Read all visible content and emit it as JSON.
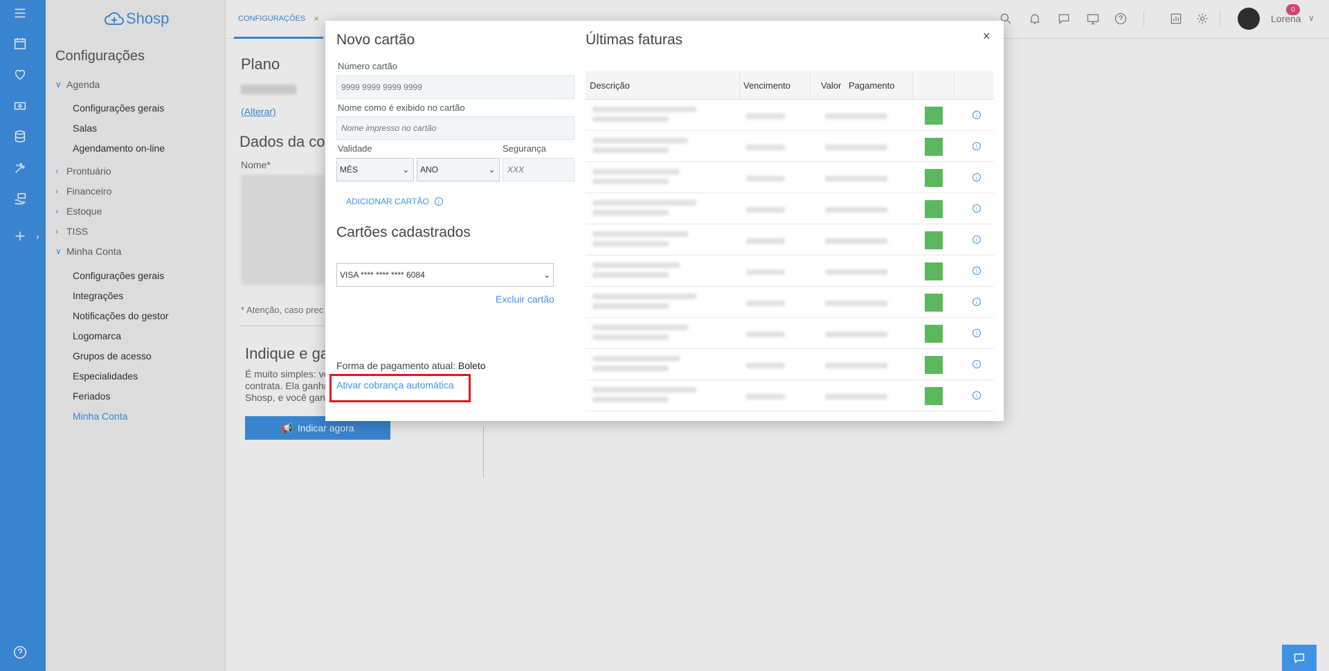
{
  "brand": {
    "name": "Shosp"
  },
  "topbar": {
    "tab_label": "CONFIGURAÇÕES",
    "tab_close": "×",
    "messages_badge": "0",
    "user_name": "Lorena"
  },
  "nav": {
    "title": "Configurações",
    "groups": [
      {
        "label": "Agenda",
        "expanded": true,
        "items": [
          "Configurações gerais",
          "Salas",
          "Agendamento on-line"
        ]
      },
      {
        "label": "Prontuário",
        "expanded": false
      },
      {
        "label": "Financeiro",
        "expanded": false
      },
      {
        "label": "Estoque",
        "expanded": false
      },
      {
        "label": "TISS",
        "expanded": false
      },
      {
        "label": "Minha Conta",
        "expanded": true,
        "items": [
          "Configurações gerais",
          "Integrações",
          "Notificações do gestor",
          "Logomarca",
          "Grupos de acesso",
          "Especialidades",
          "Feriados",
          "Minha Conta"
        ],
        "active_item": "Minha Conta"
      }
    ]
  },
  "page": {
    "plano_title": "Plano",
    "alterar": "(Alterar)",
    "dados_title": "Dados da co",
    "nome_label": "Nome*",
    "atencao": "* Atenção, caso prec",
    "indique_title": "Indique e ga",
    "indique_text_1": "É muito simples: vo",
    "indique_text_2": "contrata. Ela ganha",
    "indique_text_3": "Shosp, e você ganh",
    "indicar_button": "Indicar agora"
  },
  "modal": {
    "close": "×",
    "novo_cartao": {
      "title": "Novo cartão",
      "numero_label": "Número cartão",
      "numero_placeholder": "9999 9999 9999 9999",
      "nome_label": "Nome como é exibido no cartão",
      "nome_placeholder": "Nome impresso no cartão",
      "validade_label": "Validade",
      "mes_value": "MÊS",
      "ano_value": "ANO",
      "seguranca_label": "Segurança",
      "seguranca_placeholder": "XXX",
      "adicionar_label": "ADICIONAR CARTÃO"
    },
    "cartoes": {
      "title": "Cartões cadastrados",
      "selected_card": "VISA **** **** **** 6084",
      "excluir_label": "Excluir cartão"
    },
    "pagamento": {
      "label": "Forma de pagamento atual:",
      "value": "Boleto",
      "ativar_link": "Ativar cobrança automática"
    },
    "faturas": {
      "title": "Últimas faturas",
      "columns": [
        "Descrição",
        "Vencimento",
        "Valor",
        "Pagamento"
      ],
      "row_count_note": "10",
      "status_color": "#5cb85c"
    }
  },
  "colors": {
    "accent": "#3f92e4",
    "highlight": "#e8121a",
    "paid": "#5cb85c",
    "badge": "#e74c7a"
  }
}
